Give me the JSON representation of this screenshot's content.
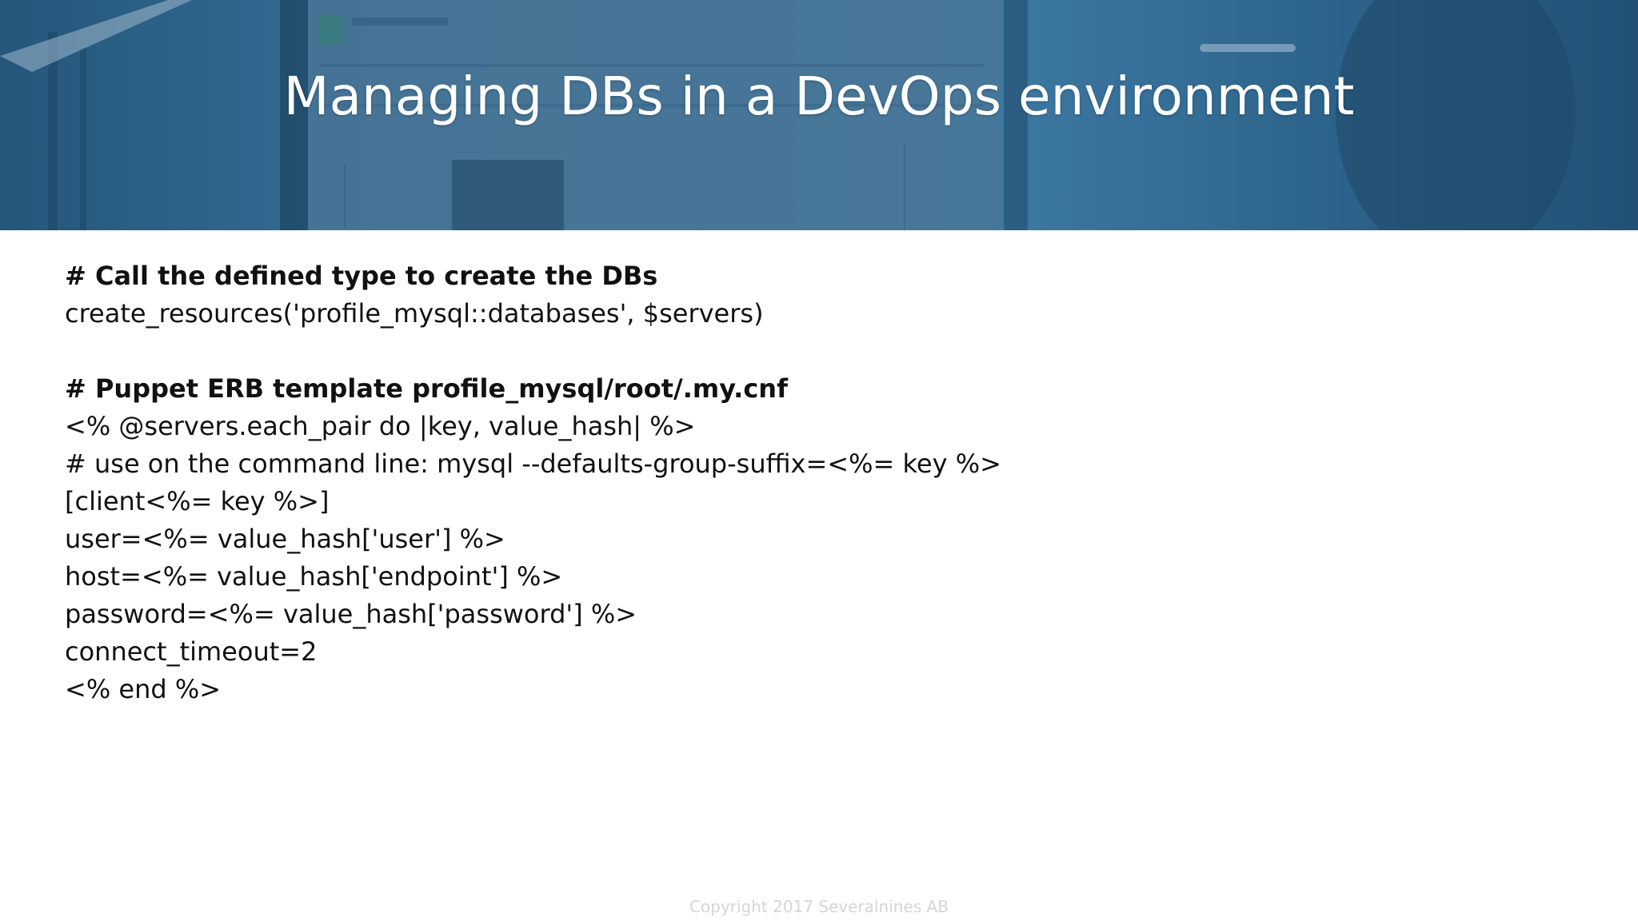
{
  "slide": {
    "title": "Managing DBs in a DevOps environment",
    "footer": "Copyright 2017 Severalnines AB"
  },
  "code": {
    "section1_comment": "# Call the defined type to create the DBs",
    "section1_line1": "create_resources('profile_mysql::databases', $servers)",
    "section2_comment": "# Puppet ERB template profile_mysql/root/.my.cnf",
    "section2_lines": [
      "<% @servers.each_pair do |key, value_hash| %>",
      "# use on the command line: mysql --defaults-group-suffix=<%= key %>",
      "[client<%= key %>]",
      "user=<%= value_hash['user'] %>",
      "host=<%= value_hash['endpoint'] %>",
      "password=<%= value_hash['password'] %>",
      "connect_timeout=2",
      "<% end %>"
    ]
  },
  "colors": {
    "banner": "#2f6a8f",
    "title_text": "#ffffff",
    "body_text": "#111111",
    "footer_text": "#d5d5d5"
  }
}
